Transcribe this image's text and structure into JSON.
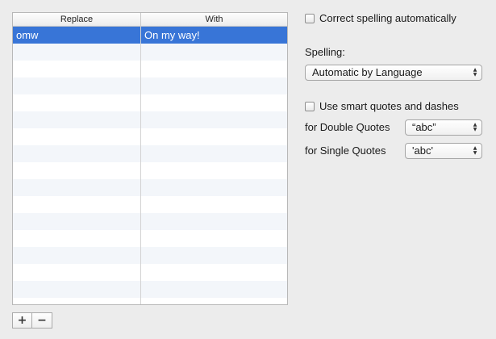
{
  "table": {
    "headers": [
      "Replace",
      "With"
    ],
    "rows": [
      {
        "replace": "omw",
        "with": "On my way!",
        "selected": true
      }
    ]
  },
  "buttons": {
    "add": "+",
    "remove": "−"
  },
  "correct_spelling": {
    "label": "Correct spelling automatically",
    "checked": false
  },
  "spelling": {
    "label": "Spelling:",
    "value": "Automatic by Language"
  },
  "smart_quotes": {
    "label": "Use smart quotes and dashes",
    "checked": false
  },
  "double_quotes": {
    "label": "for Double Quotes",
    "value": "“abc”"
  },
  "single_quotes": {
    "label": "for Single Quotes",
    "value": "'abc'"
  },
  "icons": {
    "popup_arrows": "up-down-arrows-icon"
  },
  "colors": {
    "selection": "#3875d7",
    "window_bg": "#ececec"
  }
}
